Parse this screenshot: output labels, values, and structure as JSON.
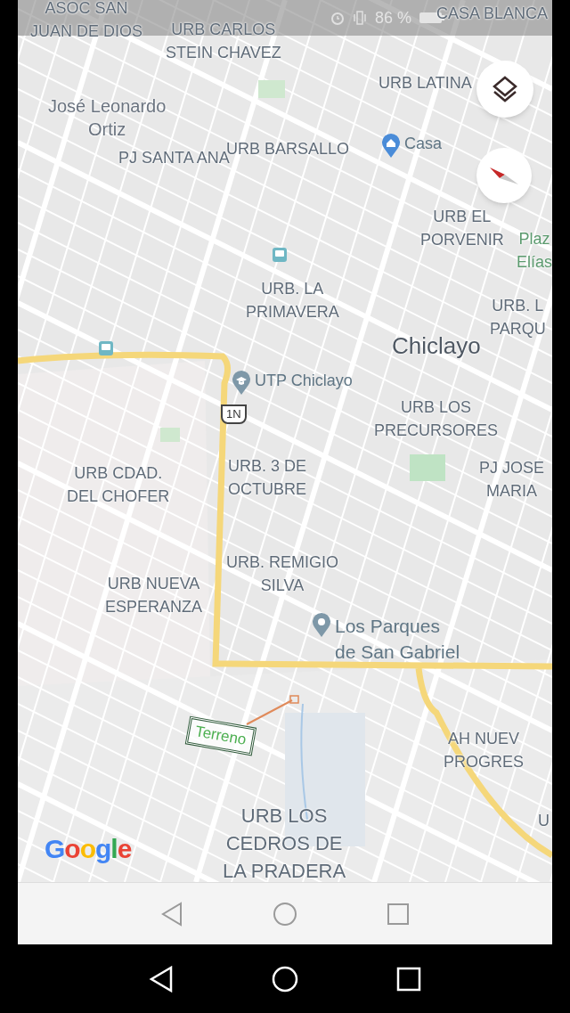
{
  "status_bar": {
    "battery": "86 %"
  },
  "map": {
    "labels": [
      {
        "kind": "area",
        "text": "ASOC SAN\nJUAN DE DIOS"
      },
      {
        "kind": "area",
        "text": "URB CARLOS\nSTEIN CHAVEZ"
      },
      {
        "kind": "area",
        "text": "CASA BLANCA"
      },
      {
        "kind": "area",
        "text": "URB LATINA"
      },
      {
        "kind": "district",
        "text": "José Leonardo\nOrtiz"
      },
      {
        "kind": "area",
        "text": "PJ SANTA ANA"
      },
      {
        "kind": "area",
        "text": "URB BARSALLO"
      },
      {
        "kind": "area",
        "text": "URB EL\nPORVENIR"
      },
      {
        "kind": "park",
        "text": "Plaz\nElías"
      },
      {
        "kind": "area",
        "text": "URB. LA\nPRIMAVERA"
      },
      {
        "kind": "area",
        "text": "URB. L\nPARQU"
      },
      {
        "kind": "city",
        "text": "Chiclayo"
      },
      {
        "kind": "area",
        "text": "URB LOS\nPRECURSORES"
      },
      {
        "kind": "area",
        "text": "URB CDAD.\nDEL CHOFER"
      },
      {
        "kind": "area",
        "text": "URB. 3 DE\nOCTUBRE"
      },
      {
        "kind": "area",
        "text": "PJ JOSE\nMARIA"
      },
      {
        "kind": "area",
        "text": "URB. REMIGIO\nSILVA"
      },
      {
        "kind": "area",
        "text": "URB NUEVA\nESPERANZA"
      },
      {
        "kind": "area",
        "text": "AH NUEV\nPROGRES"
      },
      {
        "kind": "area",
        "text": "U"
      },
      {
        "kind": "area-large",
        "text": "URB LOS\nCEDROS DE\nLA PRADERA"
      }
    ],
    "places": [
      {
        "kind": "home",
        "name": "Casa"
      },
      {
        "kind": "school",
        "name": "UTP Chiclayo"
      },
      {
        "kind": "pin",
        "name": "Los Parques\nde San Gabriel"
      }
    ],
    "road_shield": "1N",
    "annotation": "Terreno",
    "logo": "Google"
  }
}
